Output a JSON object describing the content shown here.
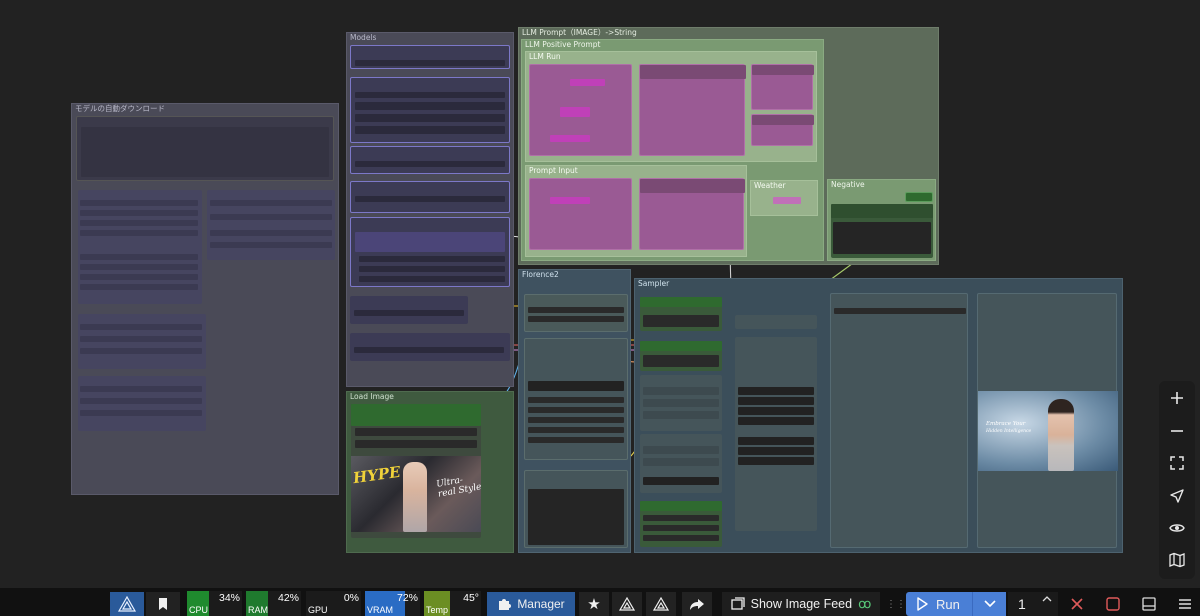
{
  "groups": {
    "auto_download": "モデルの自動ダウンロード",
    "models": "Models",
    "llm_prompt": "LLM Prompt（IMAGE）->String",
    "llm_positive": "LLM Positive Prompt",
    "llm_run": "LLM Run",
    "prompt_input": "Prompt Input",
    "weather": "Weather",
    "negative": "Negative",
    "florence2": "Florence2",
    "sampler": "Sampler",
    "load_image": "Load Image"
  },
  "loaded_image": {
    "caption": "HYPE",
    "sticker": "Ultra-real Style"
  },
  "output_image": {
    "caption_line1": "Embrace Your",
    "caption_line2": "Hidden Intelligence"
  },
  "taskbar": {
    "cpu": {
      "label": "CPU",
      "value": "34%",
      "level": 0.34,
      "color": "#1f8a2e"
    },
    "ram": {
      "label": "RAM",
      "value": "42%",
      "level": 0.42,
      "color": "#1f8a2e"
    },
    "gpu": {
      "label": "GPU",
      "value": "0%",
      "level": 0.0,
      "color": "#1f8a2e"
    },
    "vram": {
      "label": "VRAM",
      "value": "72%",
      "level": 0.72,
      "color": "#2a6cc4"
    },
    "temp": {
      "label": "Temp",
      "value": "45°",
      "level": 0.45,
      "color": "#6b8e23"
    },
    "manager_label": "Manager",
    "show_feed_label": "Show Image Feed",
    "run_label": "Run",
    "queue_count": "1"
  },
  "icons": {
    "logo": "comfy-logo-icon",
    "bookmark": "bookmark-icon",
    "puzzle": "puzzle-icon",
    "star": "star-icon",
    "share": "share-icon",
    "image_feed": "image-feed-icon",
    "run": "play-icon",
    "close": "close-icon",
    "stop": "stop-icon",
    "panel": "panel-icon",
    "menu": "menu-icon",
    "zoom_in": "plus-icon",
    "zoom_out": "minus-icon",
    "fit": "fit-view-icon",
    "navigate": "navigate-icon",
    "visibility": "eye-icon",
    "map": "map-icon"
  }
}
